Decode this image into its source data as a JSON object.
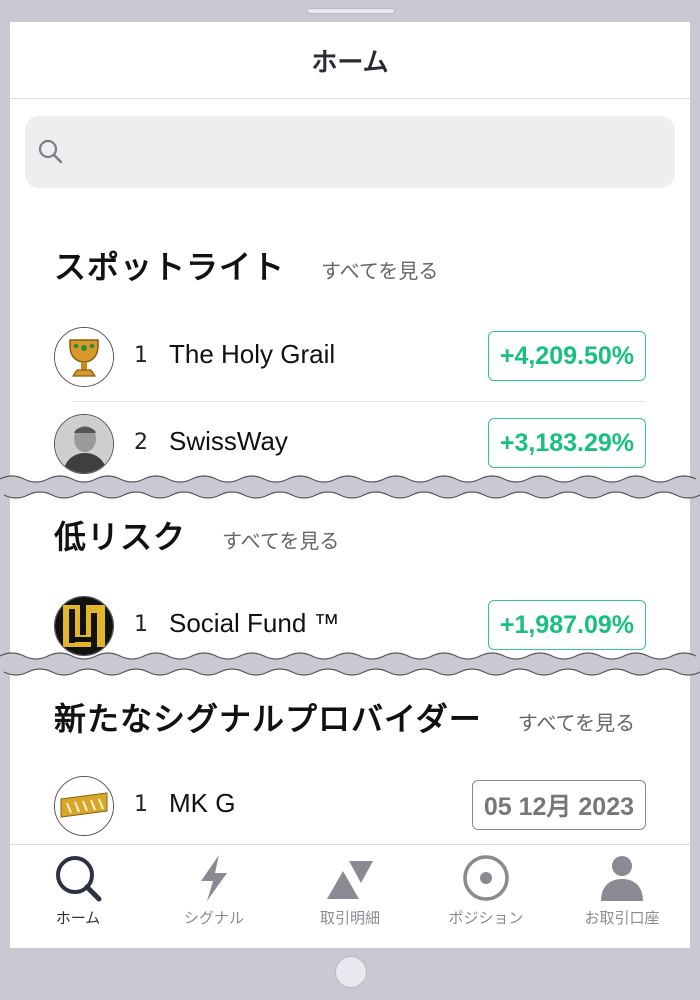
{
  "header": {
    "title": "ホーム"
  },
  "search": {
    "icon": "search-icon"
  },
  "sections": [
    {
      "title": "スポットライト",
      "see_all": "すべてを見る",
      "rows": [
        {
          "rank": "1",
          "name": "The Holy Grail",
          "value": "+4,209.50%",
          "avatar": "holy-grail-chalice"
        },
        {
          "rank": "2",
          "name": "SwissWay",
          "value": "+3,183.29%",
          "avatar": "person-photo"
        }
      ]
    },
    {
      "title": "低リスク",
      "see_all": "すべてを見る",
      "rows": [
        {
          "rank": "1",
          "name": "Social Fund ™",
          "value": "+1,987.09%",
          "avatar": "gold-black-logo"
        }
      ]
    },
    {
      "title": "新たなシグナルプロバイダー",
      "see_all": "すべてを見る",
      "rows": [
        {
          "rank": "1",
          "name": "MK G",
          "value": "05 12月 2023",
          "avatar": "gold-text-logo"
        }
      ]
    }
  ],
  "tabs": [
    {
      "label": "ホーム",
      "icon": "search-icon",
      "active": true
    },
    {
      "label": "シグナル",
      "icon": "lightning-icon",
      "active": false
    },
    {
      "label": "取引明細",
      "icon": "triangles-icon",
      "active": false
    },
    {
      "label": "ポジション",
      "icon": "target-icon",
      "active": false
    },
    {
      "label": "お取引口座",
      "icon": "person-icon",
      "active": false
    }
  ],
  "colors": {
    "positive": "#18c07f",
    "date": "#777777",
    "device": "#c9c8d3"
  }
}
